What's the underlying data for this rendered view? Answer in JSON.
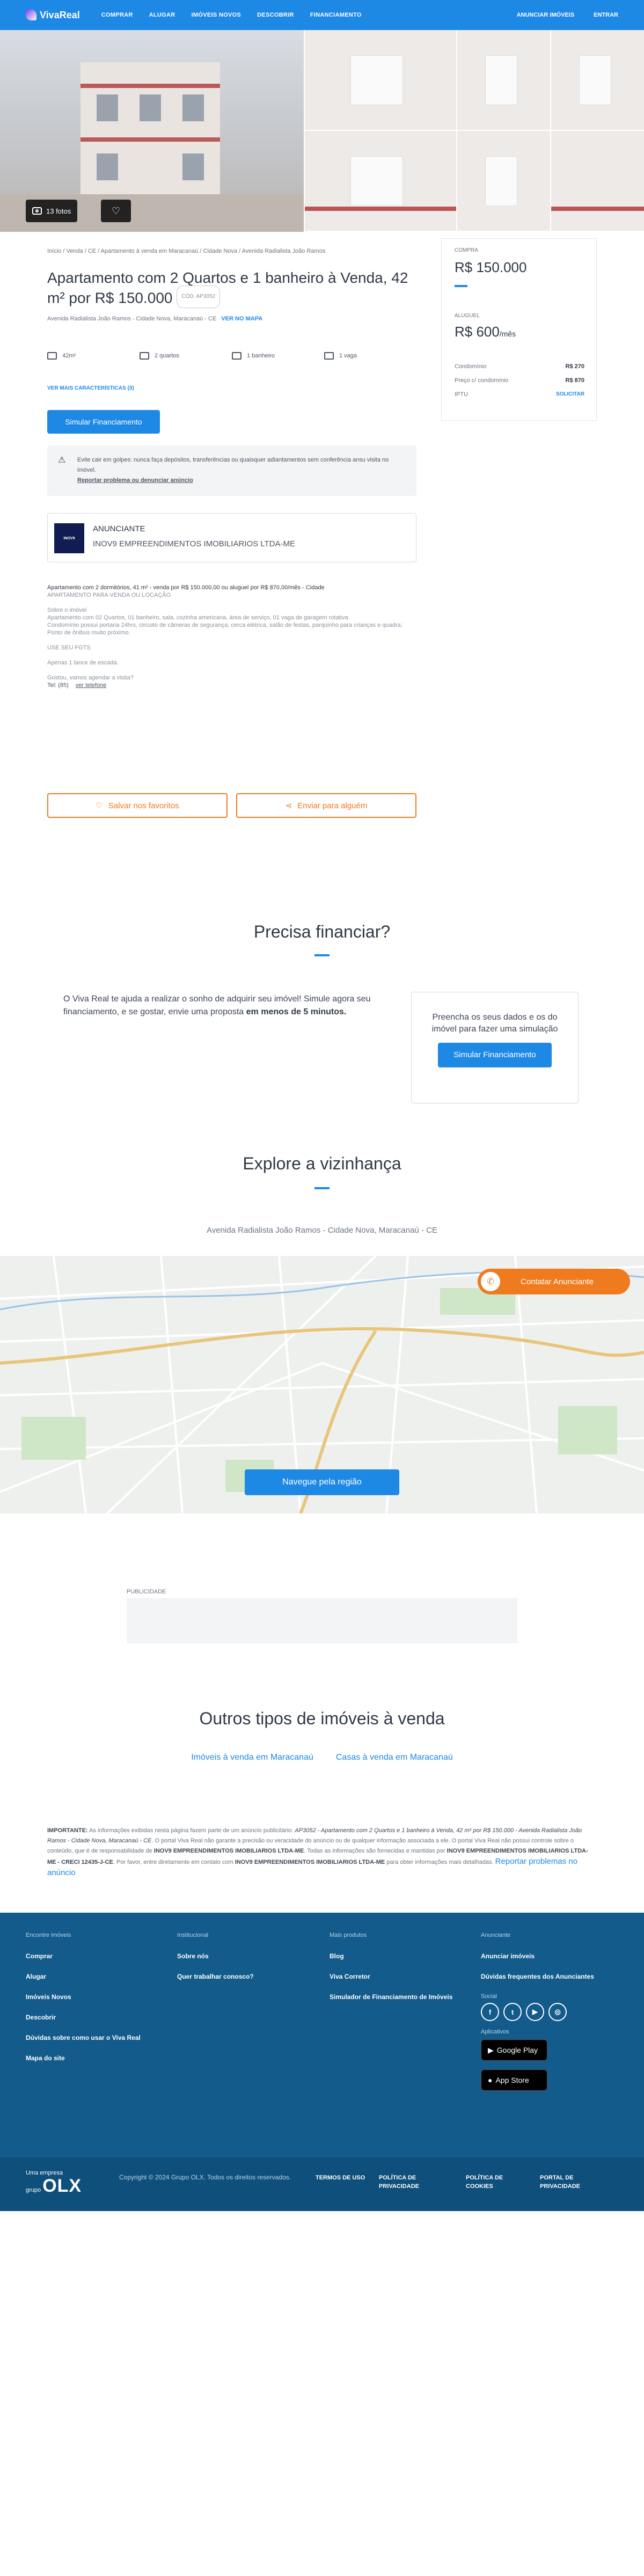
{
  "header": {
    "brand": "VivaReal",
    "nav": [
      "COMPRAR",
      "ALUGAR",
      "IMÓVEIS NOVOS",
      "DESCOBRIR",
      "FINANCIAMENTO"
    ],
    "anunciar": "ANUNCIAR IMÓVEIS",
    "entrar": "ENTRAR"
  },
  "gallery": {
    "photos_label": "13 fotos"
  },
  "listing": {
    "breadcrumb": "Início / Venda / CE / Apartamento à venda em Maracanaú / Cidade Nova / Avenida Radialista João Ramos",
    "title": "Apartamento com 2 Quartos e 1 banheiro à Venda, 42 m² por R$ 150.000",
    "code": "CÓD. AP3052",
    "address": "Avenida Radialista João Ramos - Cidade Nova, Maracanaú - CE",
    "map_link": "VER NO MAPA",
    "features": [
      {
        "icon": "area-icon",
        "label": "42m²"
      },
      {
        "icon": "bed-icon",
        "label": "2 quartos"
      },
      {
        "icon": "bath-icon",
        "label": "1 banheiro"
      },
      {
        "icon": "car-icon",
        "label": "1 vaga"
      }
    ],
    "more_features": "VER MAIS CARACTERÍSTICAS (3)",
    "simulate": "Simular Financiamento",
    "alert_text": "Evite cair em golpes: nunca faça depósitos, transferências ou quaisquer adiantamentos sem conferência ansu visita no imóvel.",
    "alert_report": "Reportar problema ou denunciar anúncio",
    "advertiser_label": "ANUNCIANTE",
    "advertiser_name": "INOV9 EMPREENDIMENTOS IMOBILIARIOS LTDA-ME",
    "advertiser_logo": "INOV9",
    "description": {
      "headline": "Apartamento com 2 dormitórios, 41 m² - venda por R$ 150.000,00 ou aluguel por R$ 870,00/mês - Cidade",
      "subline": "APARTAMENTO PARA VENDA OU LOCAÇÃO",
      "p1": "Sobre o imóvel",
      "p2": "Apartamento com 02 Quartos, 01 banheiro, sala, cozinha americana, área de serviço, 01 vaga de garagem rotativa.",
      "p3": "Condomínio possui portaria 24hrs, circuito de câmeras de segurança, cerca elétrica, salão de festas, parquinho para crianças e quadra;",
      "p4": "Ponto de ônibus muito próximo.",
      "p5": "USE SEU FGTS",
      "p6": "Apenas 1 lance de escada.",
      "p7": "Gostou, vamos agendar a visita?",
      "phone": "Tel: (85)",
      "phone_link": "ver telefone"
    },
    "save_fav": "Salvar nos favoritos",
    "send": "Enviar para alguém"
  },
  "price_card": {
    "buy_label": "COMPRA",
    "buy_value": "R$ 150.000",
    "rent_label": "ALUGUEL",
    "rent_value": "R$ 600",
    "rent_unit": "/mês",
    "rows": [
      {
        "label": "Condomínio",
        "value": "R$ 270"
      },
      {
        "label": "Preço c/ condomínio",
        "value": "R$ 870"
      },
      {
        "label": "IPTU",
        "value": "SOLICITAR"
      }
    ]
  },
  "financing": {
    "title": "Precisa financiar?",
    "text": "O Viva Real te ajuda a realizar o sonho de adquirir seu imóvel! Simule agora seu financiamento, e se gostar, envie uma proposta",
    "text_bold": "em menos de 5 minutos.",
    "card_text": "Preencha os seus dados e os do imóvel para fazer uma simulação",
    "card_button": "Simular Financiamento"
  },
  "neighborhood": {
    "title": "Explore a vizinhança",
    "address": "Avenida Radialista João Ramos - Cidade Nova, Maracanaú - CE",
    "contact": "Contatar Anunciante",
    "map_button": "Navegue pela região"
  },
  "ad": {
    "label": "PUBLICIDADE"
  },
  "others": {
    "title": "Outros tipos de imóveis à venda",
    "links": [
      "Imóveis à venda em Maracanaú",
      "Casas à venda em Maracanaú"
    ]
  },
  "disclaimer": {
    "lead": "IMPORTANTE:",
    "part1": " As informações exibidas nesta página fazem parte de um anúncio publicitário: ",
    "listing": "AP3052 - Apartamento com 2 Quartos e 1 banheiro à Venda, 42 m² por R$ 150.000 - Avenida Radialista João Ramos - Cidade Nova, Maracanaú - CE",
    "part2": ". O portal Viva Real não garante a precisão ou veracidade do anúncio ou de qualquer informação associada a ele. O portal Viva Real não possui controle sobre o conteúdo, que é de responsabilidade de ",
    "adv": "INOV9 EMPREENDIMENTOS IMOBILIARIOS LTDA-ME",
    "part3": ". Todas as informações são fornecidas e mantidas por ",
    "adv2": "INOV9 EMPREENDIMENTOS IMOBILIARIOS LTDA-ME - CRECI 12435-J-CE",
    "part4": ". Por favor, entre diretamente em contato com ",
    "adv3": "INOV9 EMPREENDIMENTOS IMOBILIARIOS LTDA-ME",
    "part5": " para obter informações mais detalhadas. ",
    "report": "Reportar problemas no anúncio"
  },
  "footer": {
    "col1": {
      "head": "Encontre imóveis",
      "links": [
        "Comprar",
        "Alugar",
        "Imóveis Novos",
        "Descobrir",
        "Dúvidas sobre como usar o Viva Real",
        "Mapa do site"
      ]
    },
    "col2": {
      "head": "Institucional",
      "links": [
        "Sobre nós",
        "Quer trabalhar conosco?"
      ]
    },
    "col3": {
      "head": "Mais produtos",
      "links": [
        "Blog",
        "Viva Corretor",
        "Simulador de Financiamento de Imóveis"
      ]
    },
    "col4": {
      "head": "Anunciante",
      "links": [
        "Anunciar imóveis",
        "Dúvidas frequentes dos Anunciantes"
      ],
      "social": "Social",
      "apps": "Aplicativos",
      "google": "Google Play",
      "apple": "App Store"
    },
    "olx_small": "Uma empresa",
    "olx_group": "grupo",
    "olx_big": "OLX",
    "copyright": "Copyright © 2024 Grupo OLX. Todos os direitos reservados.",
    "legal": [
      "TERMOS DE USO",
      "POLÍTICA DE PRIVACIDADE",
      "POLÍTICA DE COOKIES",
      "PORTAL DE PRIVACIDADE"
    ]
  }
}
